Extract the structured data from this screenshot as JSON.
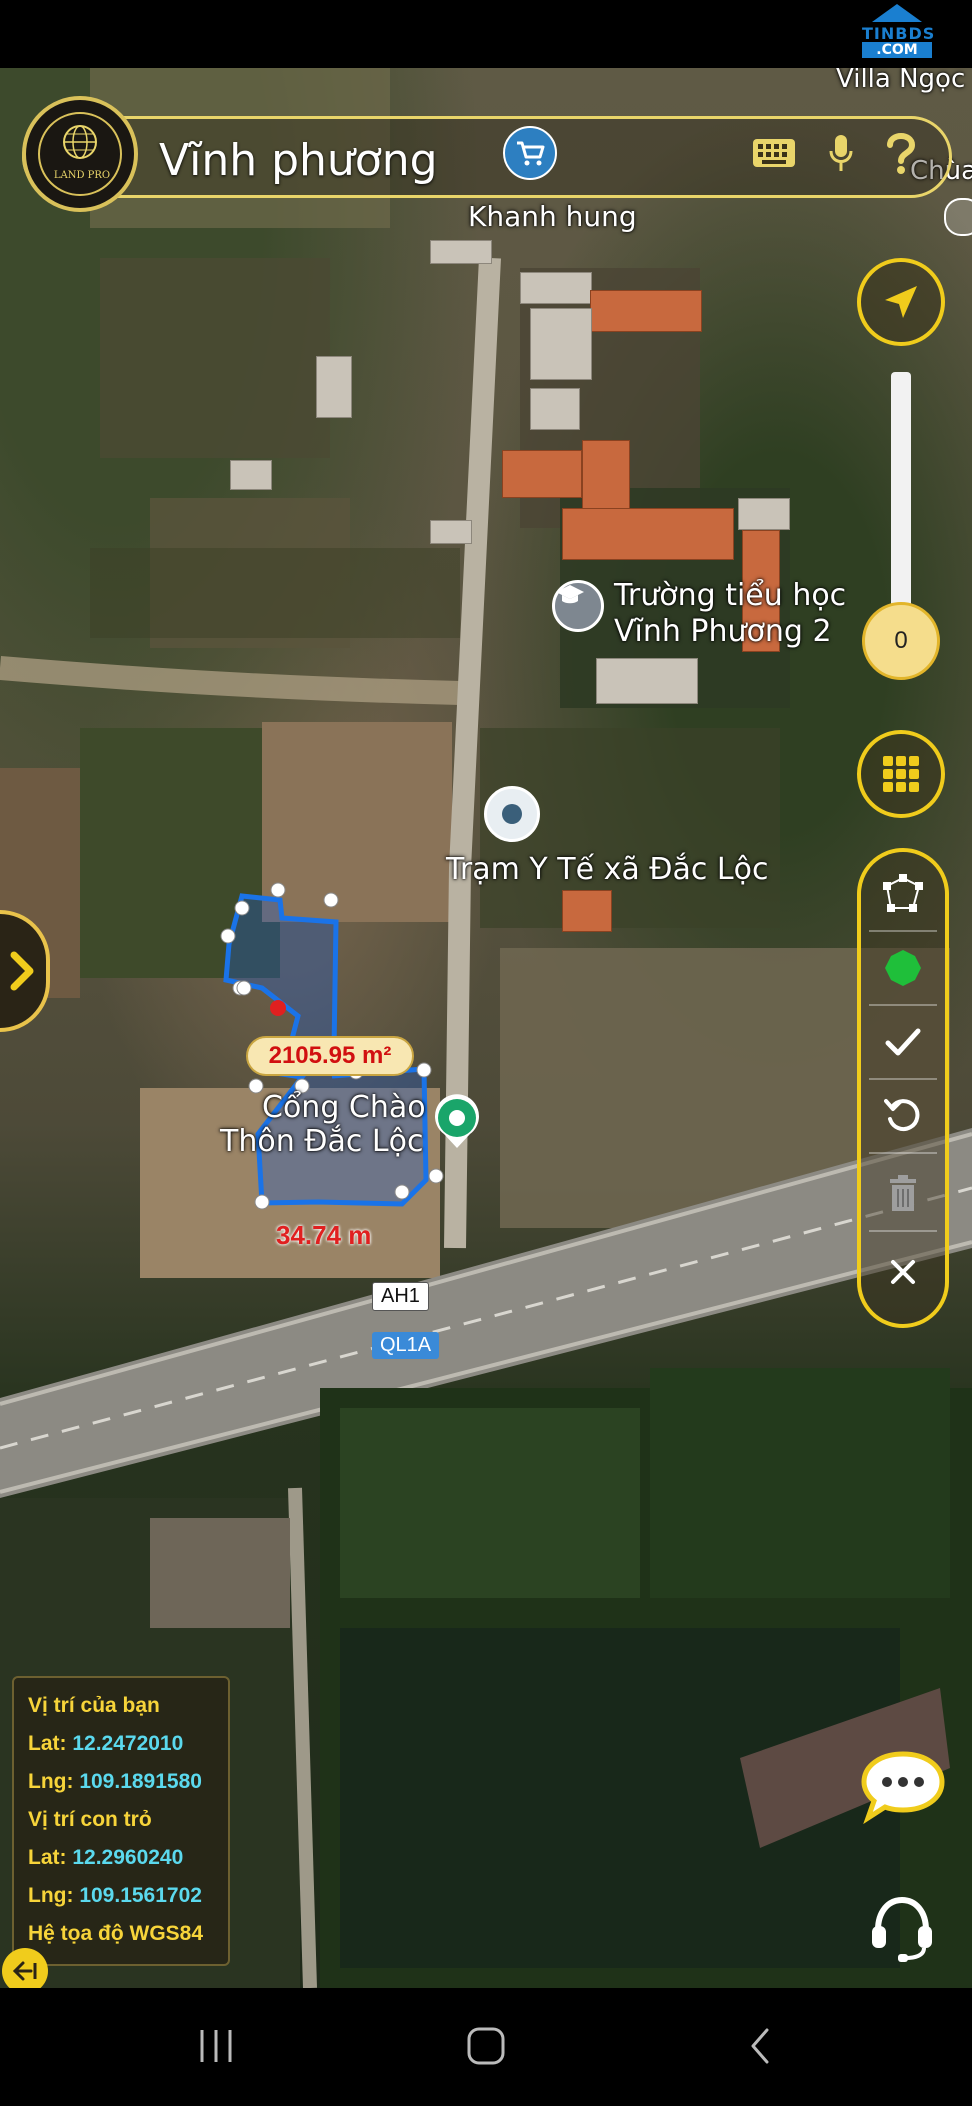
{
  "watermark": {
    "brand": "TINBDS",
    "suffix": ".COM"
  },
  "search": {
    "query": "Vĩnh phương",
    "logo_text": "LAND PRO"
  },
  "map_labels": {
    "hamlet_top": "Khanh hung",
    "school_line1": "Trường tiểu học",
    "school_line2": "Vĩnh Phương 2",
    "clinic": "Trạm Y Tế xã Đắc Lộc",
    "gate_line1": "Cổng Chào",
    "gate_line2": "Thôn Đắc Lộc",
    "top_right_a": "Villa Ngọc",
    "top_right_b": "Chùa"
  },
  "roads": {
    "ah1": "AH1",
    "ql1a": "QL1A"
  },
  "measurement": {
    "area": "2105.95 m²",
    "length": "34.74 m"
  },
  "zoom": {
    "value": "0",
    "level_fraction": 0.0
  },
  "coordinates": {
    "your_position_title": "Vị trí của bạn",
    "lat_label": "Lat:",
    "lng_label": "Lng:",
    "your_lat": "12.2472010",
    "your_lng": "109.1891580",
    "cursor_title": "Vị trí con trỏ",
    "cursor_lat": "12.2960240",
    "cursor_lng": "109.1561702",
    "system": "Hệ tọa độ WGS84"
  },
  "icons": {
    "cart": "cart-icon",
    "keyboard": "keyboard-icon",
    "mic": "microphone-icon",
    "help": "help-icon",
    "locate": "navigation-arrow-icon",
    "grid": "grid-icon",
    "polygon": "polygon-edit-icon",
    "fill": "fill-color-icon",
    "confirm": "check-icon",
    "undo": "undo-icon",
    "delete": "trash-icon",
    "close": "close-icon"
  },
  "colors": {
    "accent": "#f0cc1c",
    "polygon": "#1a73e8",
    "measure_text": "#d11010",
    "coord_cyan": "#5bd9ee",
    "coord_yellow": "#f7d43a",
    "fill_tool": "#1fbf3a"
  }
}
